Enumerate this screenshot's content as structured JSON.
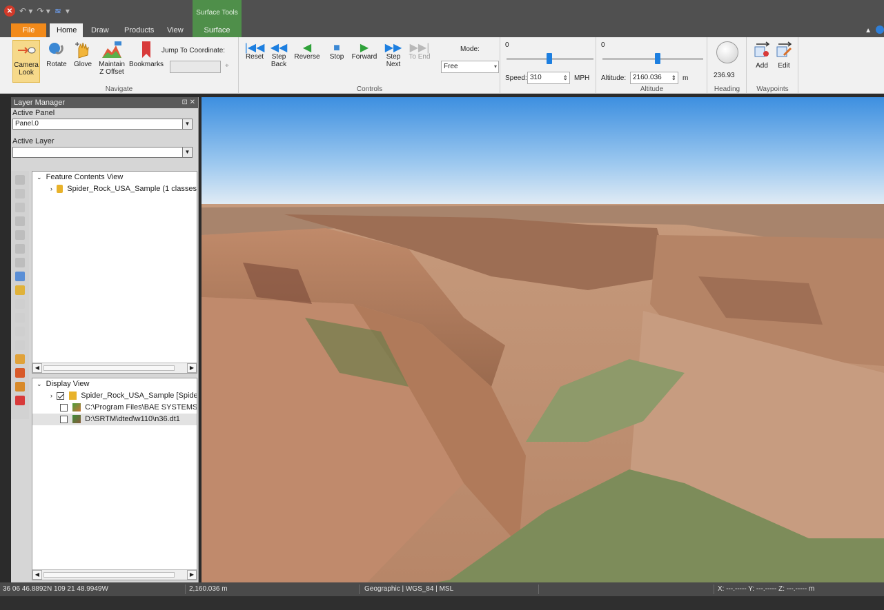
{
  "tabs": {
    "file": "File",
    "home": "Home",
    "draw": "Draw",
    "products": "Products",
    "view": "View",
    "context_group": "Surface Tools",
    "surface": "Surface"
  },
  "ribbon": {
    "navigate": {
      "title": "Navigate",
      "camera_look": "Camera\nLook",
      "rotate": "Rotate",
      "glove": "Glove",
      "maintain_z": "Maintain\nZ Offset",
      "bookmarks": "Bookmarks",
      "jump_label": "Jump To Coordinate:"
    },
    "controls": {
      "title": "Controls",
      "reset": "Reset",
      "step_back": "Step\nBack",
      "reverse": "Reverse",
      "stop": "Stop",
      "forward": "Forward",
      "step_next": "Step\nNext",
      "to_end": "To End",
      "mode_label": "Mode:",
      "mode_value": "Free",
      "speed_min": "0",
      "speed_label": "Speed:",
      "speed_value": "310",
      "speed_unit": "MPH"
    },
    "altitude": {
      "title": "Altitude",
      "min": "0",
      "label": "Altitude:",
      "value": "2160.036",
      "unit": "m"
    },
    "heading": {
      "title": "Heading",
      "value": "236.93"
    },
    "waypoints": {
      "title": "Waypoints",
      "add": "Add",
      "edit": "Edit"
    }
  },
  "layer_manager": {
    "title": "Layer Manager",
    "active_panel_label": "Active Panel",
    "active_panel_value": "Panel.0",
    "active_layer_label": "Active Layer",
    "active_layer_value": "",
    "feature_contents": {
      "root": "Feature Contents View",
      "item": "Spider_Rock_USA_Sample  (1 classes"
    },
    "display_view": {
      "root": "Display View",
      "items": [
        {
          "label": "Spider_Rock_USA_Sample [Spide",
          "checked": true
        },
        {
          "label": "C:\\Program Files\\BAE SYSTEMS\\",
          "checked": false
        },
        {
          "label": "D:\\SRTM\\dted\\w110\\n36.dt1",
          "checked": false
        }
      ]
    }
  },
  "status": {
    "coords": "36 06 46.8892N 109 21 48.9949W",
    "altitude": "2,160.036 m",
    "projection": "Geographic | WGS_84 | MSL",
    "xyz": "X: ---.----- Y: ---.----- Z: ---.----- m"
  },
  "colors": {
    "file_tab": "#f28a1a",
    "surface_tools": "#4f8f4a",
    "accent_blue": "#1d7fe0"
  }
}
